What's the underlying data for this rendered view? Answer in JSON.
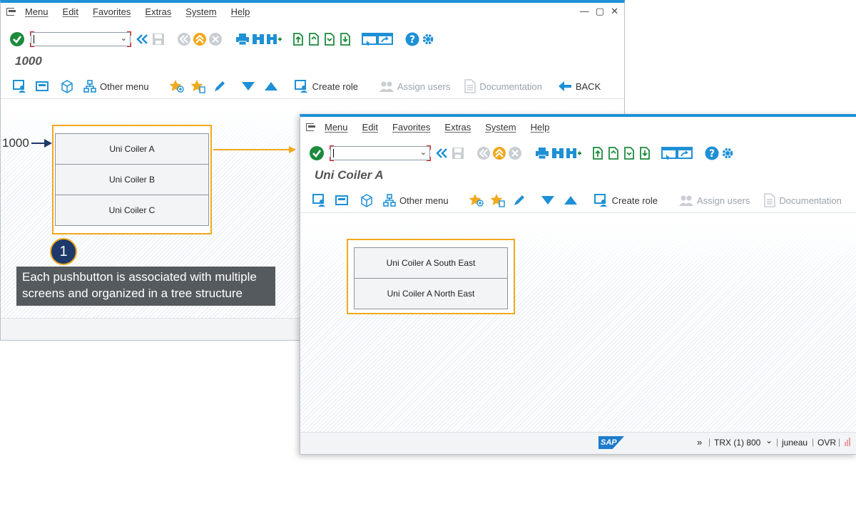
{
  "window1": {
    "menu": [
      "Menu",
      "Edit",
      "Favorites",
      "Extras",
      "System",
      "Help"
    ],
    "screen_title": "1000",
    "toolbar2": {
      "other_menu": "Other menu",
      "create_role": "Create role",
      "assign_users": "Assign users",
      "documentation": "Documentation",
      "back": "BACK"
    },
    "pushbuttons": [
      "Uni Coiler A",
      "Uni Coiler B",
      "Uni Coiler C"
    ]
  },
  "window2": {
    "menu": [
      "Menu",
      "Edit",
      "Favorites",
      "Extras",
      "System",
      "Help"
    ],
    "screen_title": "Uni Coiler A",
    "toolbar2": {
      "other_menu": "Other menu",
      "create_role": "Create role",
      "assign_users": "Assign users",
      "documentation": "Documentation"
    },
    "pushbuttons": [
      "Uni Coiler A South East",
      "Uni Coiler A North East"
    ],
    "status": {
      "sap_logo": "SAP",
      "expand": "»",
      "system": "TRX (1) 800",
      "user": "juneau",
      "mode": "OVR"
    }
  },
  "annotation": {
    "screen_label": "1000",
    "number": "1",
    "text": "Each pushbutton is associated with multiple screens and organized in a tree structure"
  },
  "colors": {
    "accent_blue": "#1e90d6",
    "highlight_orange": "#f0a91d",
    "callout_navy": "#1e3a6b",
    "icon_green": "#1d8a3c"
  }
}
